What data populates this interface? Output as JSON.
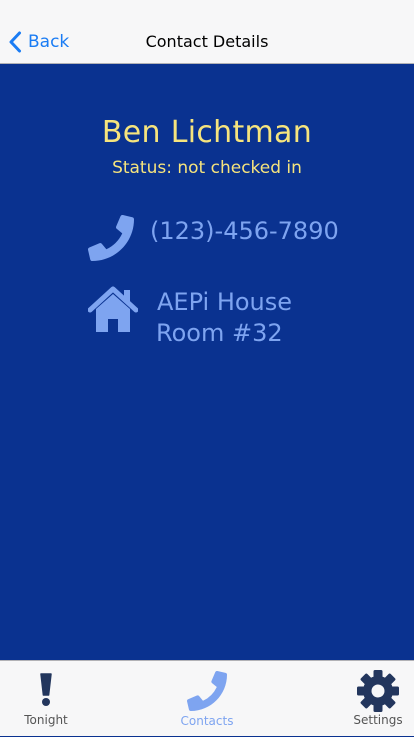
{
  "nav": {
    "back_label": "Back",
    "title": "Contact Details"
  },
  "contact": {
    "name": "Ben Lichtman",
    "status": "Status: not checked in",
    "phone": "(123)-456-7890",
    "address_line1": "AEPi House",
    "address_line2": "Room #32"
  },
  "tabs": [
    {
      "label": "Tonight",
      "icon": "exclamation-icon",
      "active": false
    },
    {
      "label": "Contacts",
      "icon": "phone-icon",
      "active": true
    },
    {
      "label": "Settings",
      "icon": "gear-icon",
      "active": false
    }
  ],
  "colors": {
    "background": "#0a3290",
    "accent_yellow": "#f6e47d",
    "accent_blue": "#7ea4f0",
    "ios_blue": "#1a7cf4",
    "icon_dark": "#23365d"
  }
}
